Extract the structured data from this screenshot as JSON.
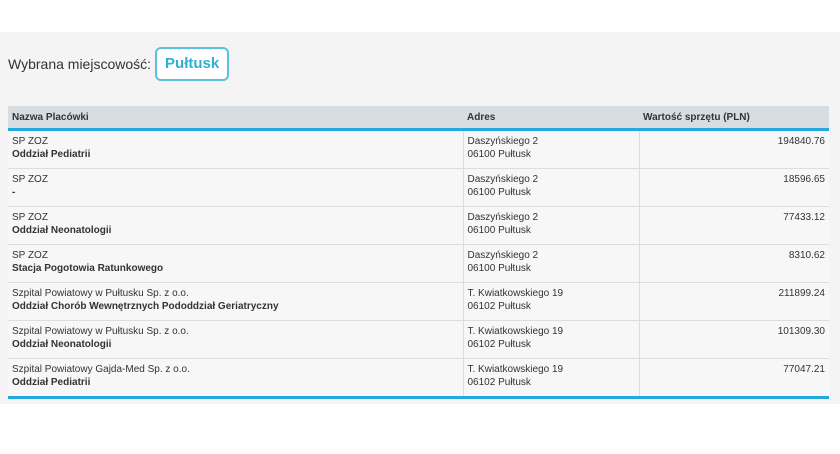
{
  "selection": {
    "label": "Wybrana miejscowość:",
    "city": "Pułtusk"
  },
  "table": {
    "headers": [
      "Nazwa Placówki",
      "Adres",
      "Wartość sprzętu (PLN)"
    ],
    "rows": [
      {
        "org": "SP ZOZ",
        "unit": "Oddział Pediatrii",
        "street": "Daszyńskiego 2",
        "postal": "06100 Pułtusk",
        "value": "194840.76"
      },
      {
        "org": "SP ZOZ",
        "unit": "-",
        "street": "Daszyńskiego 2",
        "postal": "06100 Pułtusk",
        "value": "18596.65"
      },
      {
        "org": "SP ZOZ",
        "unit": "Oddział Neonatologii",
        "street": "Daszyńskiego 2",
        "postal": "06100 Pułtusk",
        "value": "77433.12"
      },
      {
        "org": "SP ZOZ",
        "unit": "Stacja Pogotowia Ratunkowego",
        "street": "Daszyńskiego 2",
        "postal": "06100 Pułtusk",
        "value": "8310.62"
      },
      {
        "org": "Szpital Powiatowy w Pułtusku Sp. z o.o.",
        "unit": "Oddział Chorób Wewnętrznych Pododdział Geriatryczny",
        "street": "T. Kwiatkowskiego 19",
        "postal": "06102 Pułtusk",
        "value": "211899.24"
      },
      {
        "org": "Szpital Powiatowy w Pułtusku Sp. z o.o.",
        "unit": "Oddział Neonatologii",
        "street": "T. Kwiatkowskiego 19",
        "postal": "06102 Pułtusk",
        "value": "101309.30"
      },
      {
        "org": "Szpital Powiatowy Gajda-Med Sp. z o.o.",
        "unit": "Oddział Pediatrii",
        "street": "T. Kwiatkowskiego 19",
        "postal": "06102 Pułtusk",
        "value": "77047.21"
      }
    ]
  },
  "colors": {
    "accent": "#23a9dd",
    "badge_border": "#5bc0de",
    "header_bg": "#d8dde2"
  }
}
